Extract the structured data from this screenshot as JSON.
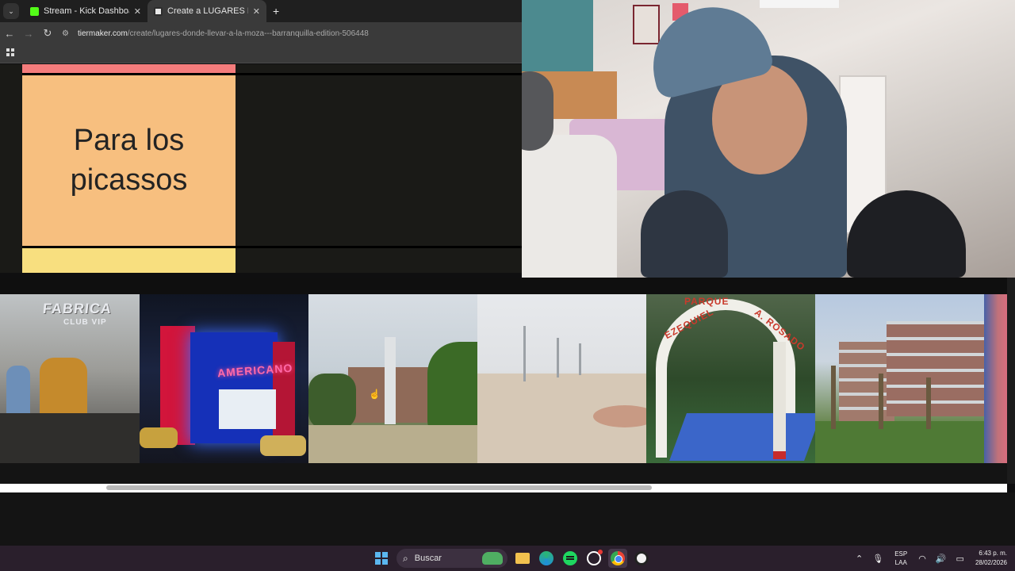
{
  "browser": {
    "tabs": [
      {
        "title": "Stream - Kick Dashboard",
        "icon": "kick-icon"
      },
      {
        "title": "Create a LUGARES DONDE LLEVAR...",
        "icon": "tiermaker-icon",
        "active": true
      }
    ],
    "new_tab": "+",
    "url_domain": "tiermaker.com",
    "url_path": "/create/lugares-donde-llevar-a-la-moza---barranquilla-edition-506448"
  },
  "tierlist": {
    "rows": [
      {
        "label": "",
        "color": "#f47c7c"
      },
      {
        "label": "Para los picassos",
        "color": "#f7bf7f"
      },
      {
        "label": "",
        "color": "#f8df7f"
      }
    ]
  },
  "pool": {
    "items": [
      {
        "name": "fabrica-club-vip",
        "text_main": "FABRICA",
        "text_sub": "CLUB VIP"
      },
      {
        "name": "americano",
        "text_main": "AMERICANO"
      },
      {
        "name": "cristo-rey-statue"
      },
      {
        "name": "malecon-paving"
      },
      {
        "name": "parque-ezequiel-rosado",
        "text_main": "PARQUE",
        "text_left": "EZEQUIEL",
        "text_right": "A. ROSADO"
      },
      {
        "name": "university-building"
      },
      {
        "name": "partial-item"
      }
    ]
  },
  "taskbar": {
    "search_placeholder": "Buscar",
    "lang_top": "ESP",
    "lang_bottom": "LAA",
    "time": "6:43 p. m.",
    "date": "28/02/2026"
  },
  "colors": {
    "kick_green": "#53fc18",
    "taskbar_bg": "#2a1f2c",
    "tier_s": "#f47c7c",
    "tier_a": "#f7bf7f",
    "tier_b": "#f8df7f"
  }
}
